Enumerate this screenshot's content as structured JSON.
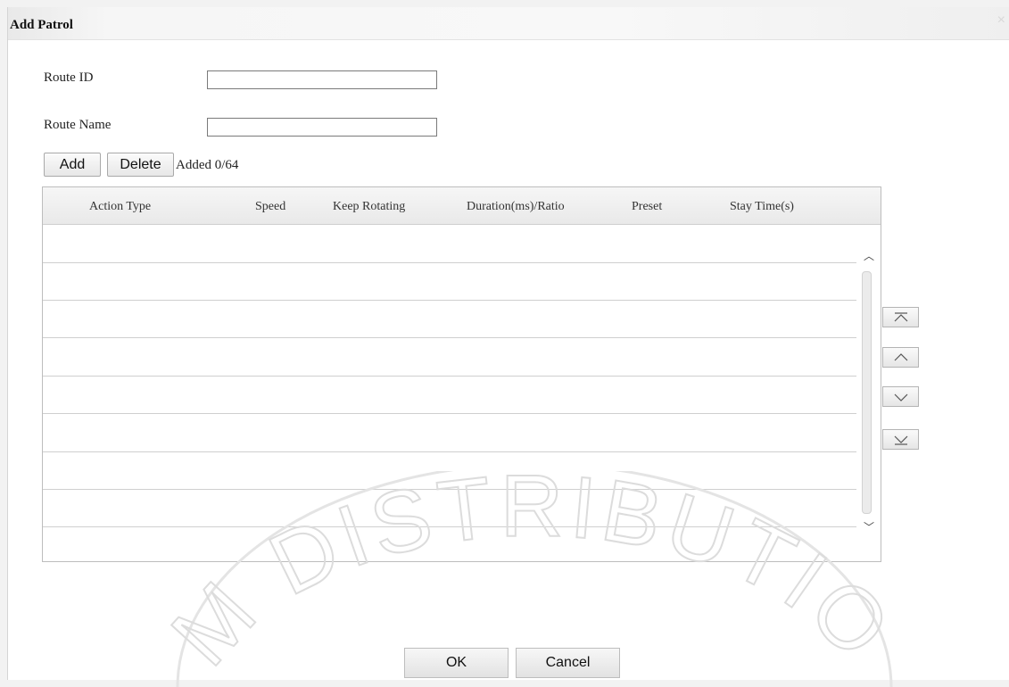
{
  "dialog": {
    "title": "Add Patrol",
    "close_glyph": "×"
  },
  "form": {
    "route_id_label": "Route ID",
    "route_id_value": "",
    "route_name_label": "Route Name",
    "route_name_value": ""
  },
  "toolbar": {
    "add_label": "Add",
    "delete_label": "Delete",
    "added_count": "Added 0/64"
  },
  "table": {
    "columns": [
      "Action Type",
      "Speed",
      "Keep Rotating",
      "Duration(ms)/Ratio",
      "Preset",
      "Stay Time(s)"
    ],
    "rows": []
  },
  "move_buttons": {
    "icons": [
      "move-to-top-icon",
      "move-up-icon",
      "move-down-icon",
      "move-to-bottom-icon"
    ]
  },
  "footer": {
    "ok_label": "OK",
    "cancel_label": "Cancel"
  },
  "watermark": {
    "text": "AM DISTRIBUTION"
  }
}
